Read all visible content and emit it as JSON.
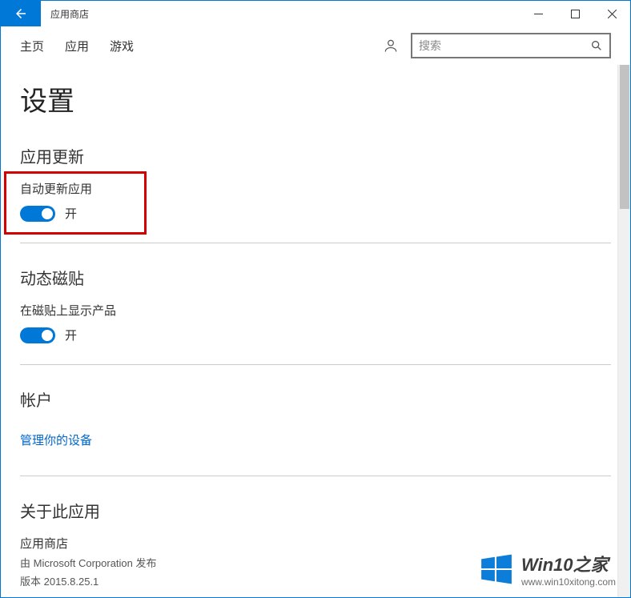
{
  "window": {
    "title": "应用商店"
  },
  "nav": {
    "home": "主页",
    "apps": "应用",
    "games": "游戏"
  },
  "search": {
    "placeholder": "搜索"
  },
  "page": {
    "heading": "设置"
  },
  "sections": {
    "app_updates": {
      "title": "应用更新",
      "auto_update_label": "自动更新应用",
      "toggle_state": "开"
    },
    "live_tile": {
      "title": "动态磁贴",
      "show_products_label": "在磁贴上显示产品",
      "toggle_state": "开"
    },
    "account": {
      "title": "帐户",
      "manage_devices": "管理你的设备"
    },
    "about": {
      "title": "关于此应用",
      "app_name": "应用商店",
      "publisher": "由 Microsoft Corporation 发布",
      "version": "版本 2015.8.25.1"
    }
  },
  "watermark": {
    "main": "Win10之家",
    "sub": "www.win10xitong.com"
  }
}
